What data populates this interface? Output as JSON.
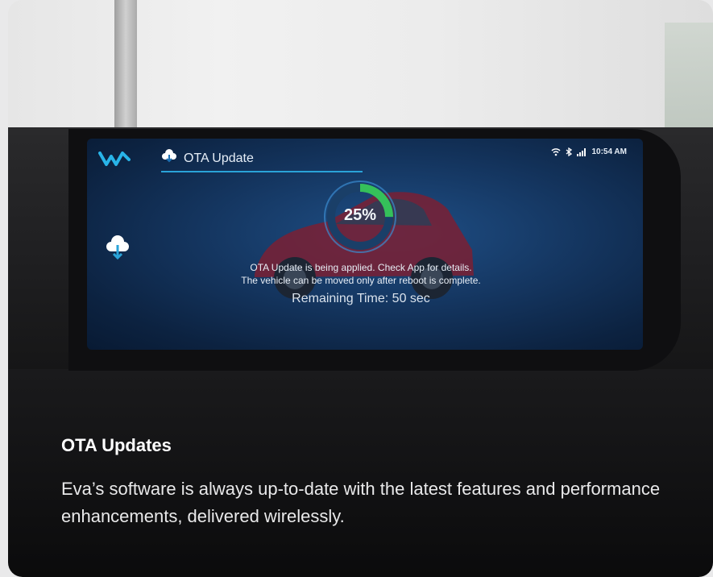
{
  "screen": {
    "tab_label": "OTA Update",
    "status_time": "10:54 AM",
    "progress_text": "25%",
    "progress": 0.25,
    "message_line1": "OTA Update is being applied. Check App for details.",
    "message_line2": "The vehicle can be moved only after reboot is complete.",
    "remaining": "Remaining Time: 50 sec",
    "icons": [
      "brand-logo-icon",
      "cloud-icon",
      "wifi-icon",
      "bluetooth-icon",
      "signal-icon",
      "cloud-download-icon"
    ]
  },
  "caption": {
    "title": "OTA Updates",
    "body": "Eva’s software is always up-to-date with the latest features and performance enhancements, delivered wirelessly."
  },
  "colors": {
    "accent": "#2aa3d8",
    "progress_green": "#35c05a"
  }
}
